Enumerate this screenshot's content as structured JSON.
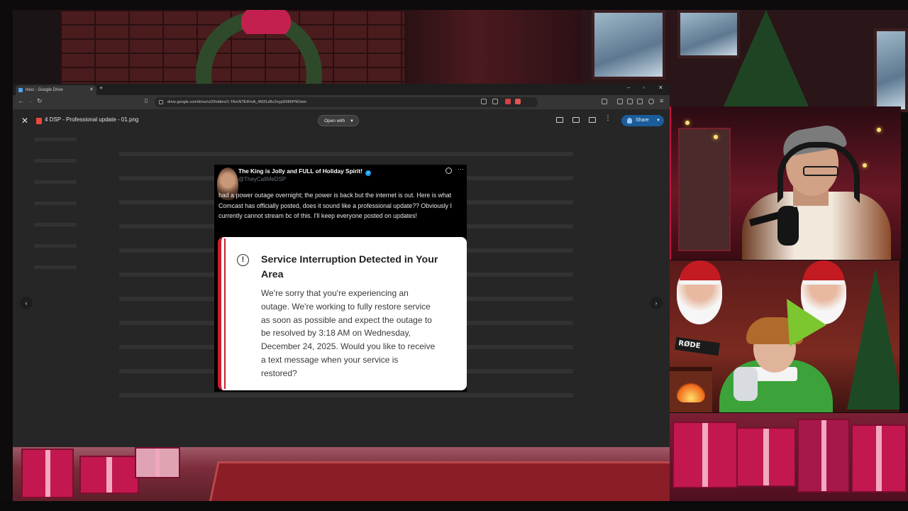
{
  "browser": {
    "tab_title": "misc - Google Drive",
    "new_tab_label": "+",
    "window_controls": {
      "minimize": "–",
      "restore": "▫",
      "close": "✕"
    },
    "url": "drive.google.com/drive/u/2/folders/1-TArnNTEiFmA_4M31zBcZeypD085PNOwm"
  },
  "drive_viewer": {
    "close_label": "✕",
    "file_name": "4 DSP - Professional update - 01.png",
    "open_with_label": "Open with",
    "share_label": "Share",
    "prev_arrow": "‹",
    "next_arrow": "›",
    "zoom": {
      "minus": "−",
      "magnifier": "⌕",
      "plus": "+"
    }
  },
  "tweet": {
    "display_name": "The King is Jolly and FULL of Holiday Spirit!",
    "verified_mark": "✓",
    "handle": "@TheyCallMeDSP",
    "more_label": "···",
    "text": "had a power outage overnight; the power is back but the internet is out. Here is what Comcast has officially posted, does it sound like a professional update?? Obviously I currently cannot stream bc of this. I'll keep everyone posted on updates!"
  },
  "service_alert": {
    "icon_glyph": "!",
    "title": "Service Interruption Detected in Your Area",
    "body": "We're sorry that you're experiencing an outage. We're working to fully restore service as soon as possible and expect the outage to be resolved by 3:18 AM on Wednesday, December 24, 2025. Would you like to receive a text message when your service is restored?"
  },
  "webcam_bottom": {
    "mic_brand": "RØDE"
  },
  "colors": {
    "share_button": "#1a5d9a",
    "alert_accent": "#c8202f",
    "verified_badge": "#1d9bf0",
    "viewer_background": "#262626"
  },
  "icons": {
    "back": "back-arrow-icon",
    "forward": "forward-arrow-icon",
    "reload": "reload-icon",
    "bookmark": "bookmark-icon",
    "add_shortcut": "add-shortcut-icon",
    "comment": "comment-icon",
    "print": "print-icon",
    "alert": "exclamation-circle-icon"
  }
}
